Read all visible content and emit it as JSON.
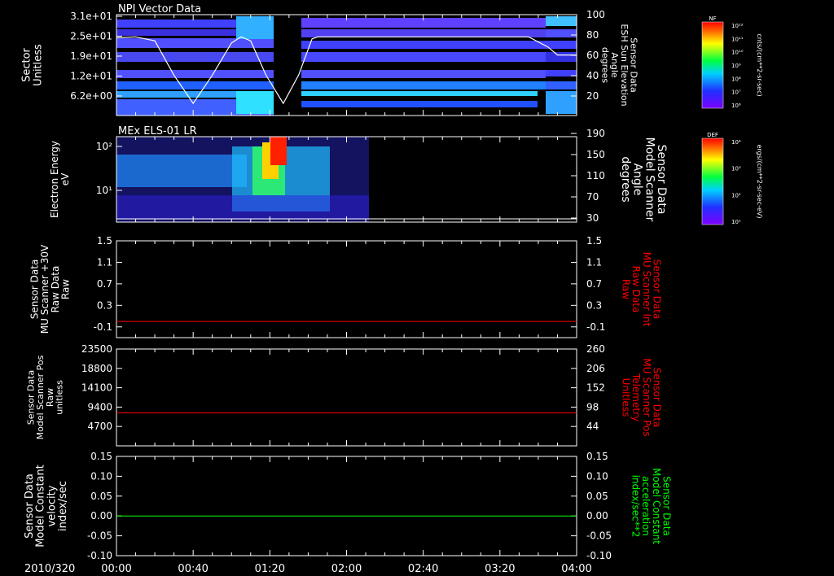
{
  "chart_data": [
    {
      "type": "heatmap",
      "title": "NPI Vector Data",
      "ylabel": "Sector\nUnitless",
      "yticks": [
        "3.1e+01",
        "2.5e+01",
        "1.9e+01",
        "1.2e+01",
        "6.2e+00"
      ],
      "right_ylabel": "Sensor Data\nESH Sun Elevation\nAngle\ndegrees",
      "right_yticks": [
        "100",
        "80",
        "60",
        "40",
        "20"
      ],
      "right_ylim": [
        0,
        100
      ],
      "colorbar": {
        "label": "NF",
        "unit": "cnts/(cm**2-sr-sec)",
        "ticks": [
          "10¹²",
          "10¹¹",
          "10¹⁰",
          "10⁹",
          "10⁸",
          "10⁷",
          "10⁶"
        ]
      },
      "series": [
        {
          "x": [
            "00:00",
            "00:20",
            "00:40",
            "01:00",
            "01:20",
            "01:40",
            "02:00",
            "03:40",
            "04:00"
          ],
          "values": [
            77,
            75,
            12,
            78,
            12,
            78,
            78,
            78,
            60
          ]
        }
      ]
    },
    {
      "type": "heatmap",
      "title": "MEx ELS-01 LR",
      "ylabel": "Electron Energy\neV",
      "yticks": [
        "10²",
        "10¹"
      ],
      "right_ylabel": "Sensor Data\nModel Scanner\nAngle\ndegrees",
      "right_yticks": [
        "190",
        "150",
        "110",
        "70",
        "30"
      ],
      "colorbar": {
        "label": "DEF",
        "unit": "ergs/(cm**2-sr-sec-eV)",
        "ticks": [
          "10⁴",
          "10³",
          "10²",
          "10¹"
        ]
      },
      "series": [
        {
          "x": [
            "00:00",
            "04:00"
          ],
          "values": [
            10,
            10
          ]
        }
      ]
    },
    {
      "type": "line",
      "ylabel": "Sensor Data\nMU Scanner +30V\nRaw Data\nRaw",
      "yticks": [
        "1.5",
        "1.1",
        "0.7",
        "0.3",
        "-0.1"
      ],
      "ylim": [
        -0.3,
        1.5
      ],
      "right_ylabel": "Sensor Data\nMU Scanner Int\nRaw Data\nRaw",
      "right_yticks": [
        "1.5",
        "1.1",
        "0.7",
        "0.3",
        "-0.1"
      ],
      "series": [
        {
          "x": [
            "00:00",
            "04:00"
          ],
          "values": [
            0.0,
            0.0
          ],
          "color": "#ff0000"
        }
      ]
    },
    {
      "type": "line",
      "ylabel": "Sensor Data\nModel Scanner Pos\nRaw\nunitless",
      "yticks": [
        "23500",
        "18800",
        "14100",
        "9400",
        "4700"
      ],
      "ylim": [
        0,
        23500
      ],
      "right_ylabel": "Sensor Data\nMU Scanner Pos\nTelemetry\nUnitless",
      "right_yticks": [
        "260",
        "206",
        "152",
        "98",
        "44"
      ],
      "series": [
        {
          "x": [
            "00:00",
            "04:00"
          ],
          "values": [
            8000,
            8000
          ],
          "color": "#ff0000"
        }
      ]
    },
    {
      "type": "line",
      "ylabel": "Sensor Data\nModel Constant\nvelocity\nindex/sec",
      "yticks": [
        "0.15",
        "0.10",
        "0.05",
        "0.00",
        "-0.05",
        "-0.10"
      ],
      "ylim": [
        -0.1,
        0.15
      ],
      "right_ylabel": "Sensor Data\nModel Constant\nacceleration\nindex/sec**2",
      "right_yticks": [
        "0.15",
        "0.10",
        "0.05",
        "0.00",
        "-0.05",
        "-0.10"
      ],
      "series": [
        {
          "x": [
            "00:00",
            "04:00"
          ],
          "values": [
            0.0,
            0.0
          ],
          "color": "#00ff00"
        }
      ]
    }
  ],
  "xaxis": {
    "date": "2010/320",
    "ticks": [
      "00:00",
      "00:40",
      "01:20",
      "02:00",
      "02:40",
      "03:20",
      "04:00"
    ]
  }
}
